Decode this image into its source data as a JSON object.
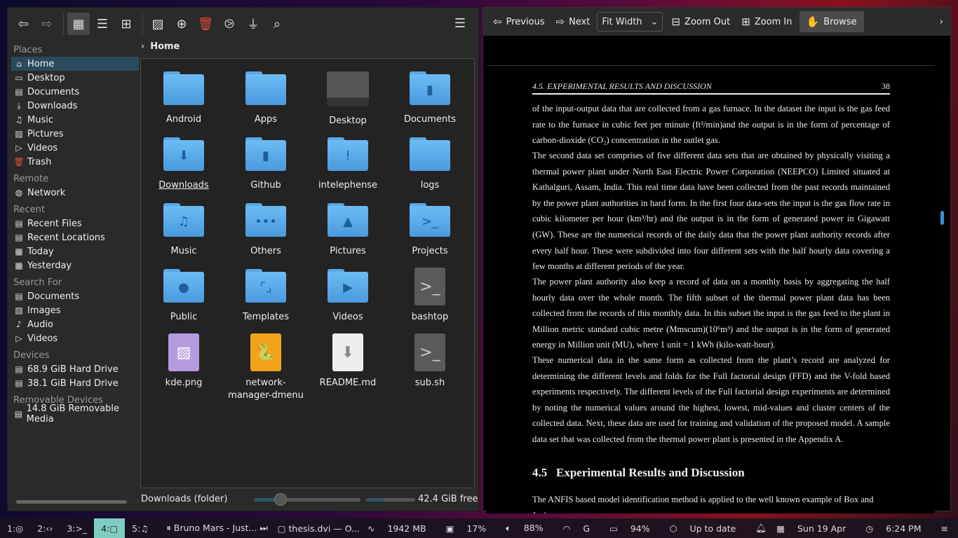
{
  "file_manager": {
    "toolbar": {
      "back": "back-icon",
      "forward": "forward-icon",
      "icons_view": "icons-view",
      "details_view": "details-view",
      "tree_view": "tree-view",
      "preview": "preview",
      "new_folder": "new",
      "delete": "delete",
      "terminal": "terminal",
      "filter": "filter",
      "search": "search",
      "menu": "menu"
    },
    "breadcrumb": "Home",
    "sidebar": [
      {
        "heading": "Places",
        "items": [
          {
            "label": "Home",
            "icon": "⌂",
            "selected": true
          },
          {
            "label": "Desktop",
            "icon": "▭"
          },
          {
            "label": "Documents",
            "icon": "▤"
          },
          {
            "label": "Downloads",
            "icon": "⤓"
          },
          {
            "label": "Music",
            "icon": "♫"
          },
          {
            "label": "Pictures",
            "icon": "▨"
          },
          {
            "label": "Videos",
            "icon": "▷"
          },
          {
            "label": "Trash",
            "icon": "🗑"
          }
        ]
      },
      {
        "heading": "Remote",
        "items": [
          {
            "label": "Network",
            "icon": "◍"
          }
        ]
      },
      {
        "heading": "Recent",
        "items": [
          {
            "label": "Recent Files",
            "icon": "▤"
          },
          {
            "label": "Recent Locations",
            "icon": "▤"
          },
          {
            "label": "Today",
            "icon": "▦"
          },
          {
            "label": "Yesterday",
            "icon": "▦"
          }
        ]
      },
      {
        "heading": "Search For",
        "items": [
          {
            "label": "Documents",
            "icon": "▤"
          },
          {
            "label": "Images",
            "icon": "▨"
          },
          {
            "label": "Audio",
            "icon": "♪"
          },
          {
            "label": "Videos",
            "icon": "▷"
          }
        ]
      },
      {
        "heading": "Devices",
        "items": [
          {
            "label": "68.9 GiB Hard Drive",
            "icon": "▤"
          },
          {
            "label": "38.1 GiB Hard Drive",
            "icon": "▤"
          }
        ]
      },
      {
        "heading": "Removable Devices",
        "items": [
          {
            "label": "14.8 GiB Removable Media",
            "icon": "▤"
          }
        ]
      }
    ],
    "files": [
      {
        "name": "Android",
        "type": "folder",
        "emblem": ""
      },
      {
        "name": "Apps",
        "type": "folder",
        "emblem": ""
      },
      {
        "name": "Desktop",
        "type": "desktop",
        "emblem": ""
      },
      {
        "name": "Documents",
        "type": "folder",
        "emblem": "▮"
      },
      {
        "name": "Downloads",
        "type": "folder",
        "emblem": "⬇",
        "selected": true
      },
      {
        "name": "Github",
        "type": "folder",
        "emblem": "▮"
      },
      {
        "name": "intelephense",
        "type": "folder",
        "emblem": "!"
      },
      {
        "name": "logs",
        "type": "folder",
        "emblem": ""
      },
      {
        "name": "Music",
        "type": "folder",
        "emblem": "♫"
      },
      {
        "name": "Others",
        "type": "folder",
        "emblem": "•••"
      },
      {
        "name": "Pictures",
        "type": "folder",
        "emblem": "▲"
      },
      {
        "name": "Projects",
        "type": "folder",
        "emblem": ">_"
      },
      {
        "name": "Public",
        "type": "folder",
        "emblem": "●"
      },
      {
        "name": "Templates",
        "type": "folder",
        "emblem": "⌜⌟"
      },
      {
        "name": "Videos",
        "type": "folder",
        "emblem": "▶"
      },
      {
        "name": "bashtop",
        "type": "script",
        "emblem": ">_"
      },
      {
        "name": "kde.png",
        "type": "image",
        "emblem": "▨"
      },
      {
        "name": "network-manager-dmenu",
        "type": "python",
        "emblem": "🐍"
      },
      {
        "name": "README.md",
        "type": "text",
        "emblem": "⬇"
      },
      {
        "name": "sub.sh",
        "type": "script",
        "emblem": ">_"
      }
    ],
    "status": "Downloads (folder)",
    "zoom_level": 0.25,
    "disk_used_fraction": 0.35,
    "free_space": "42.4 GiB free"
  },
  "viewer": {
    "toolbar": {
      "previous": "Previous",
      "next": "Next",
      "zoom_mode": "Fit Width",
      "zoom_out": "Zoom Out",
      "zoom_in": "Zoom In",
      "browse": "Browse"
    },
    "header": {
      "section": "4.5.  EXPERIMENTAL RESULTS AND DISCUSSION",
      "page": "38"
    },
    "paragraphs": [
      "of the input-output data that are collected from a gas furnace.  In the dataset the input is the gas feed rate to the furnace in cubic feet per minute (ft³/min)and the output is in the form of percentage of carbon-dioxide (CO₂) concentration in the outlet gas.",
      "The second data set comprises of five different data sets that are obtained by physically visiting a thermal power plant under North East Electric Power Corporation (NEEPCO) Limited situated at Kathalguri, Assam, India.  This real time data have been collected from the past records maintained by the power plant authorities in hard form.  In the first four data-sets the input is the gas flow rate in cubic kilometer per hour (km³/hr) and the output is in the form of generated power in Gigawatt (GW). These are the numerical records of the daily data that the power plant authority records after every half hour. These were subdivided into four different sets with the half hourly data covering a few months at different periods of the year.",
      "The power plant authority also keep a record of data on a monthly basis by aggregating the half hourly data over the whole month.  The fifth subset of the thermal power plant data has been collected from the records of this monthly data.  In this subset the input is the gas feed to the plant in Million metric standard cubic metre (Mmscum)(10⁶m³) and the output is in the form of generated energy in Million unit (MU), where 1 unit = 1 kWh (kilo-watt-hour).",
      "These numerical data in the same form as collected from the plant’s record are analyzed for determining the different levels and folds for the Full factorial design (FFD) and the V-fold based experiments respectively.  The different levels of the Full factorial design experiments are determined by noting the numerical values around the highest, lowest, mid-values and cluster centers of the collected data. Next, these data are used for training and validation of the proposed model. A sample data set that was collected from the thermal power plant is presented in the Appendix A."
    ],
    "section_number": "4.5",
    "section_title": "Experimental Results and Discussion",
    "last_line": "The ANFIS based model identification method is applied to the well known example of Box and Jenk-"
  },
  "taskbar": {
    "workspaces": [
      {
        "label": "1:",
        "icon": "◎"
      },
      {
        "label": "2:",
        "icon": "‹›"
      },
      {
        "label": "3:",
        "icon": ">_"
      },
      {
        "label": "4:",
        "icon": "▢",
        "active": true
      },
      {
        "label": "5:",
        "icon": "♫"
      }
    ],
    "media": "Bruno Mars - Just...",
    "window": "thesis.dvi — O...",
    "memory": "1942 MB",
    "cpu": "17%",
    "volume": "88%",
    "wifi": "G",
    "battery": "94%",
    "updates": "Up to date",
    "date": "Sun 19 Apr",
    "time": "6:24 PM",
    "accent": "#7ecdc0"
  }
}
